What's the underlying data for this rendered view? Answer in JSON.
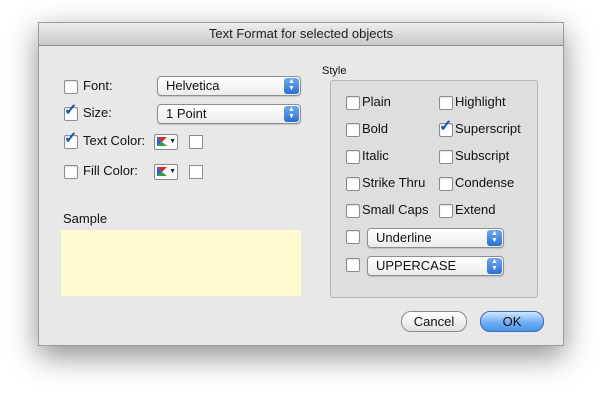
{
  "dialog": {
    "title": "Text Format for selected objects"
  },
  "left": {
    "font": {
      "label": "Font:",
      "checked": false,
      "value": "Helvetica"
    },
    "size": {
      "label": "Size:",
      "checked": true,
      "value": "1 Point"
    },
    "text_color": {
      "label": "Text Color:",
      "checked": true
    },
    "fill_color": {
      "label": "Fill Color:",
      "checked": false
    },
    "sample_label": "Sample",
    "sample_bg": "#fdfbcf"
  },
  "style": {
    "group_label": "Style",
    "options": {
      "plain": {
        "label": "Plain",
        "checked": false
      },
      "highlight": {
        "label": "Highlight",
        "checked": false
      },
      "bold": {
        "label": "Bold",
        "checked": false
      },
      "superscript": {
        "label": "Superscript",
        "checked": true
      },
      "italic": {
        "label": "Italic",
        "checked": false
      },
      "subscript": {
        "label": "Subscript",
        "checked": false
      },
      "strike_thru": {
        "label": "Strike Thru",
        "checked": false
      },
      "condense": {
        "label": "Condense",
        "checked": false
      },
      "small_caps": {
        "label": "Small Caps",
        "checked": false
      },
      "extend": {
        "label": "Extend",
        "checked": false
      }
    },
    "underline_popup": {
      "checked": false,
      "value": "Underline"
    },
    "case_popup": {
      "checked": false,
      "value": "UPPERCASE"
    }
  },
  "buttons": {
    "cancel": "Cancel",
    "ok": "OK"
  },
  "colors": {
    "accent": "#3c7fe0",
    "dialog_bg": "#e8e8e8"
  }
}
